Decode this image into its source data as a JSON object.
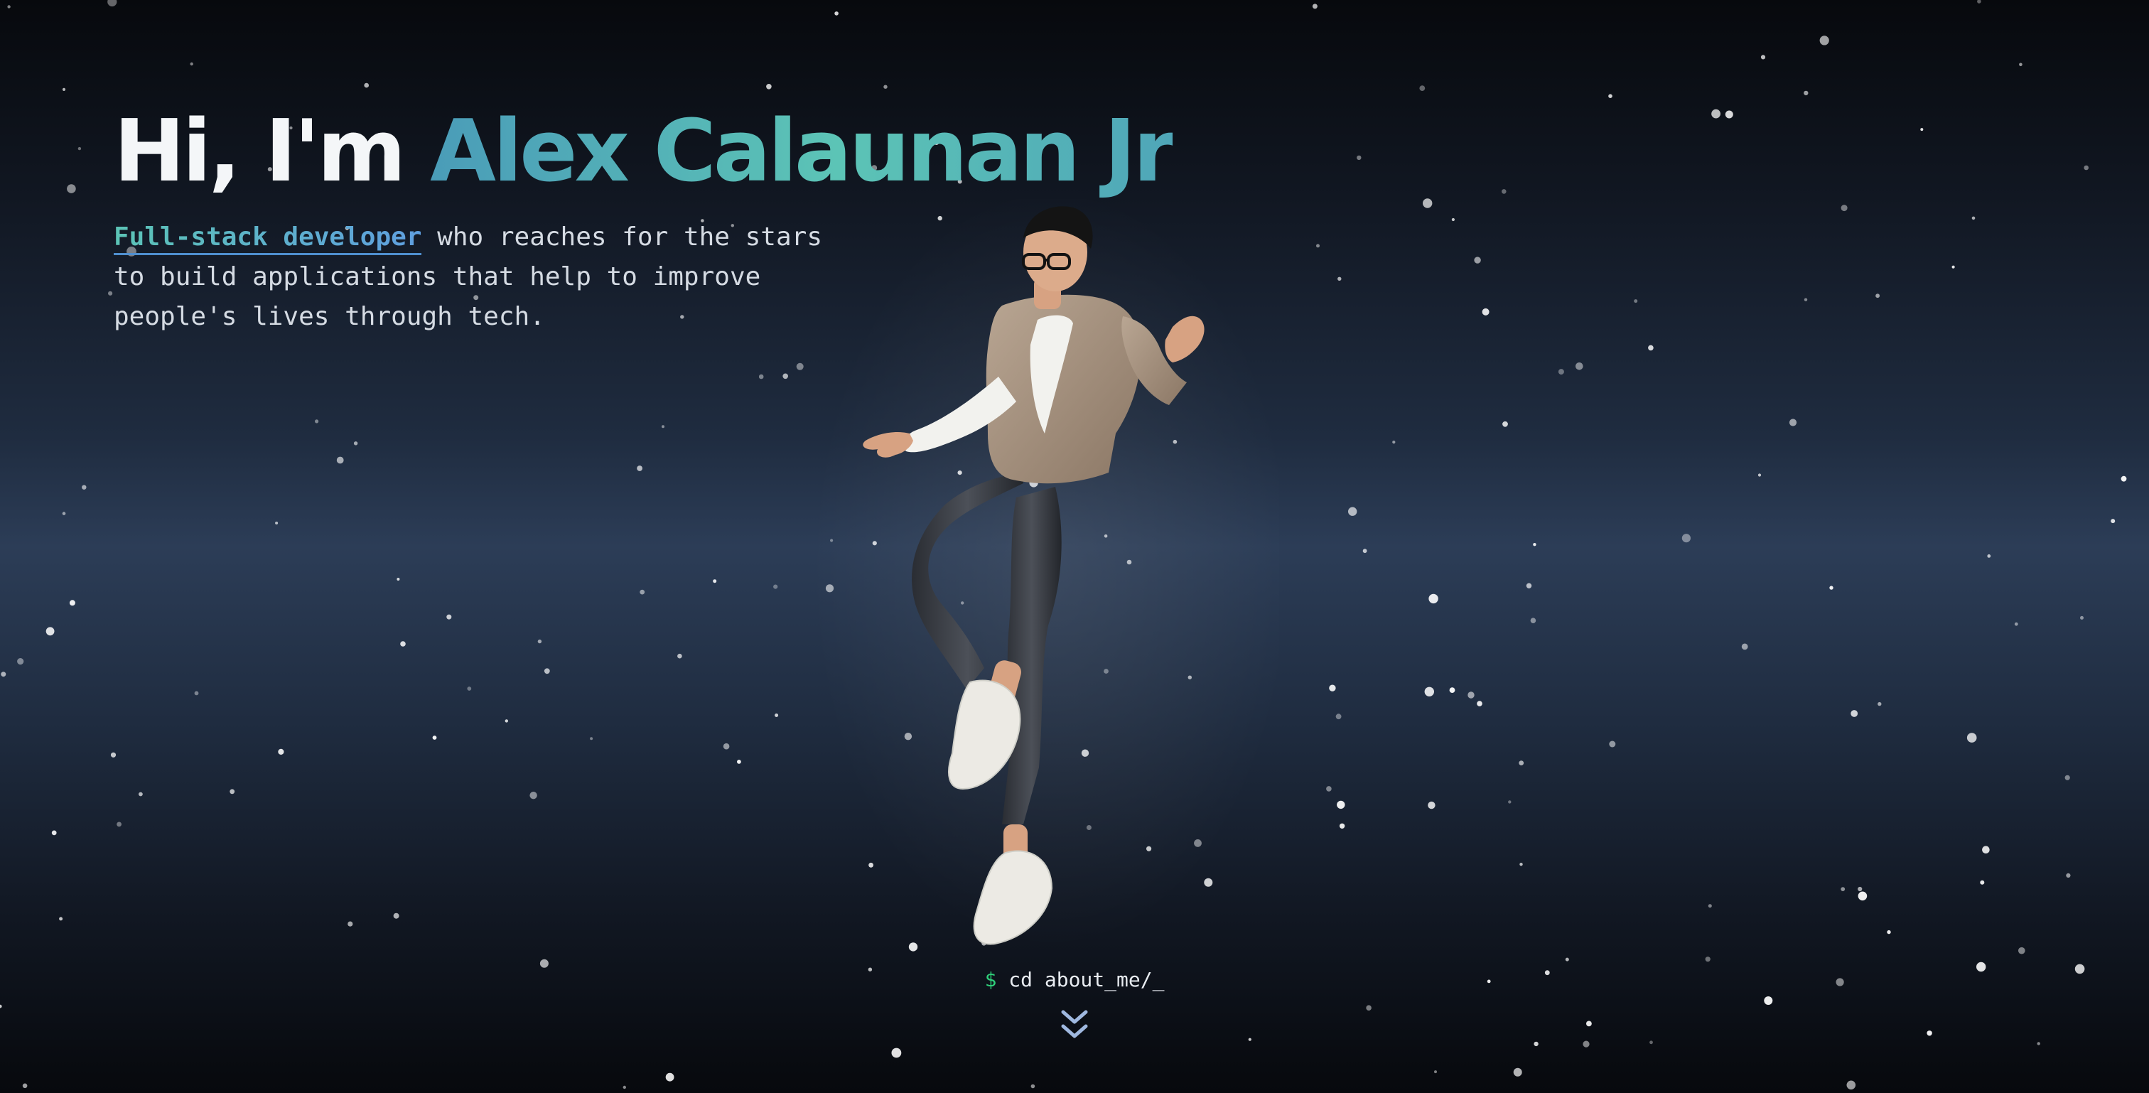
{
  "hero": {
    "greeting": "Hi, I'm ",
    "name": "Alex Calaunan Jr",
    "role_highlight": "Full-stack developer",
    "tagline_rest": " who reaches for the stars to build applications that help to improve people's lives through tech."
  },
  "terminal": {
    "prompt_symbol": "$",
    "command": "cd about_me/",
    "cursor": "_"
  },
  "icons": {
    "scroll_down": "double-chevron-down-icon",
    "avatar": "3d-avatar-figure"
  },
  "colors": {
    "name_gradient_start": "#4a9cb8",
    "name_gradient_end": "#5cc4b6",
    "prompt": "#2fd07a",
    "chevron": "#9fb8df"
  }
}
